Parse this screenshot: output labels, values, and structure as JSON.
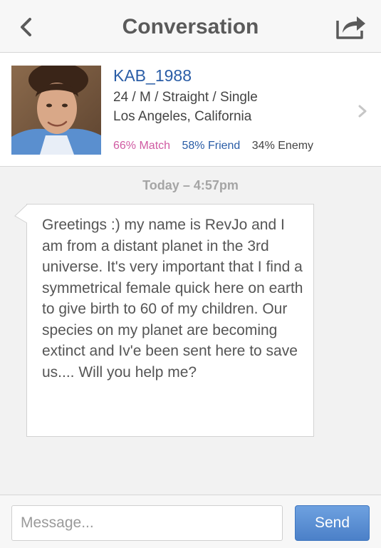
{
  "header": {
    "title": "Conversation",
    "back_icon": "chevron-left-icon",
    "share_icon": "share-icon"
  },
  "profile": {
    "username": "KAB_1988",
    "details": "24 / M / Straight / Single",
    "location": "Los Angeles, California",
    "match": "66% Match",
    "friend": "58% Friend",
    "enemy": "34% Enemy",
    "colors": {
      "username": "#2a5da6",
      "match": "#d05aa2",
      "friend": "#2a5da6"
    }
  },
  "thread": {
    "timestamp": "Today – 4:57pm",
    "messages": [
      {
        "text": "Greetings :) my name is RevJo and I am from a distant planet in the 3rd universe. It's very important that I find a symmetrical female quick here on earth to give birth to 60 of my children. Our species on my planet are becoming extinct and Iv'e been sent here to save us.... Will you help me?"
      }
    ]
  },
  "composer": {
    "placeholder": "Message...",
    "value": "",
    "send_label": "Send"
  }
}
